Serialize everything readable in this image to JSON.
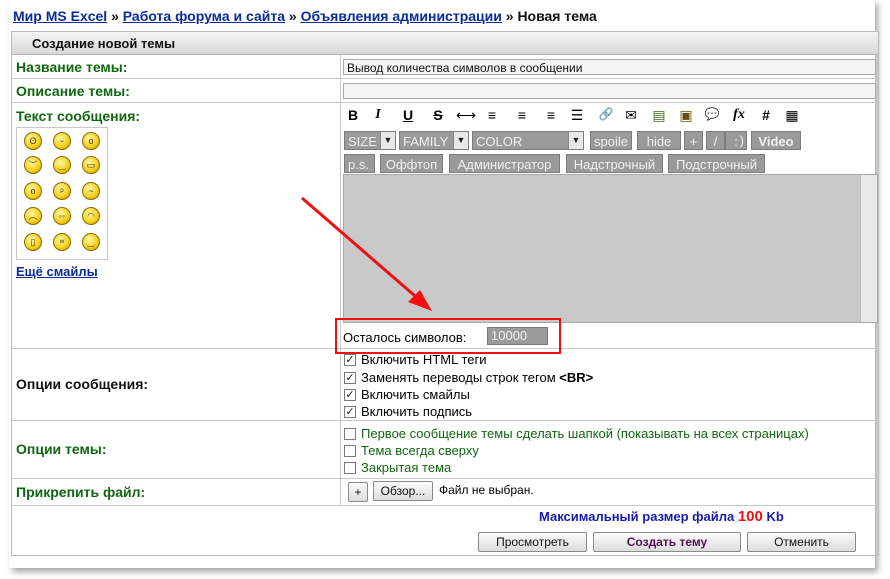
{
  "breadcrumb": {
    "items": [
      "Мир MS Excel",
      "Работа форума и сайта",
      "Объявления администрации"
    ],
    "separator": "»",
    "current": "Новая тема"
  },
  "header": {
    "title": "Создание новой темы"
  },
  "fields": {
    "title_label": "Название темы:",
    "title_value": "Вывод количества символов в сообщении",
    "desc_label": "Описание темы:",
    "desc_value": "",
    "message_label": "Текст сообщения:",
    "more_smileys": "Ещё смайлы"
  },
  "toolbar": {
    "format_icons": [
      "bold-icon",
      "italic-icon",
      "underline-icon",
      "strikethrough-icon",
      "horizontal-rule-icon",
      "align-left-icon",
      "align-center-icon",
      "align-right-icon",
      "list-icon",
      "link-icon",
      "email-icon",
      "image-icon",
      "picture-icon",
      "quote-icon",
      "formula-icon",
      "hash-icon",
      "table-icon"
    ],
    "format_glyphs": [
      "B",
      "I",
      "U",
      "S",
      "⟷",
      "≡",
      "≡",
      "≡",
      "☰",
      "🔗",
      "✉",
      "▤",
      "▣",
      "💬",
      "fx",
      "#",
      "▦"
    ],
    "size": "SIZE",
    "family": "FAMILY",
    "color": "COLOR",
    "row1_buttons": [
      "spoile",
      "hide",
      "+",
      "/",
      ":",
      ")",
      "Video"
    ],
    "row2_buttons": [
      "p.s.",
      "Оффтоп",
      "Администратор",
      "Надстрочный",
      "Подстрочный"
    ]
  },
  "counter": {
    "label": "Осталось символов:",
    "value": "10000"
  },
  "message_options": {
    "label": "Опции сообщения:",
    "items": [
      {
        "text": "Включить HTML теги",
        "checked": true
      },
      {
        "text": "Заменять переводы строк тегом",
        "bold": "<BR>",
        "checked": true
      },
      {
        "text": "Включить смайлы",
        "checked": true
      },
      {
        "text": "Включить подпись",
        "checked": true
      }
    ]
  },
  "topic_options": {
    "label": "Опции темы:",
    "items": [
      {
        "text": "Первое сообщение темы сделать шапкой (показывать на всех страницах)",
        "checked": false
      },
      {
        "text": "Тема всегда сверху",
        "checked": false
      },
      {
        "text": "Закрытая тема",
        "checked": false
      }
    ]
  },
  "attach": {
    "label": "Прикрепить файл:",
    "plus": "+",
    "browse": "Обзор...",
    "status": "Файл не выбран."
  },
  "max_size": {
    "prefix": "Максимальный размер файла",
    "value": "100",
    "unit": "Kb"
  },
  "buttons": {
    "preview": "Просмотреть",
    "create": "Создать тему",
    "cancel": "Отменить"
  },
  "colors": {
    "label_green": "#116611",
    "link_blue": "#0a2a9a",
    "highlight_red": "#e11111",
    "counter_bg": "#9a9a9a"
  }
}
